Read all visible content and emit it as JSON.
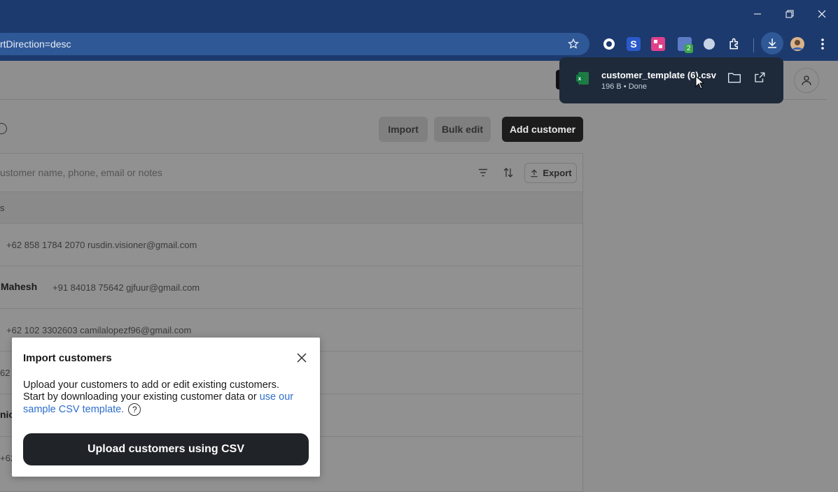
{
  "browser": {
    "url": "rtDirection=desc",
    "extension_badge": "2"
  },
  "download": {
    "filename": "customer_template (6).csv",
    "meta": "196 B • Done"
  },
  "toolbar": {
    "import_label": "Import",
    "bulk_edit_label": "Bulk edit",
    "add_customer_label": "Add customer",
    "export_label": "Export"
  },
  "search": {
    "placeholder": "ustomer name, phone, email or notes"
  },
  "table": {
    "header": "s",
    "rows": [
      {
        "name": "",
        "contact": "+62 858 1784 2070 rusdin.visioner@gmail.com"
      },
      {
        "name": "Mahesh",
        "contact": "+91 84018 75642 gjfuur@gmail.com"
      },
      {
        "name": "",
        "contact": "+62 102 3302603 camilalopezf96@gmail.com"
      },
      {
        "name": "",
        "contact": "62"
      },
      {
        "name": "nic",
        "contact": ""
      },
      {
        "name": "",
        "contact": "+62"
      }
    ]
  },
  "modal": {
    "title": "Import customers",
    "body1": "Upload your customers to add or edit existing customers.",
    "body2": "Start by downloading your existing customer data or ",
    "link": "use our sample CSV template.",
    "upload_label": "Upload customers using CSV"
  }
}
